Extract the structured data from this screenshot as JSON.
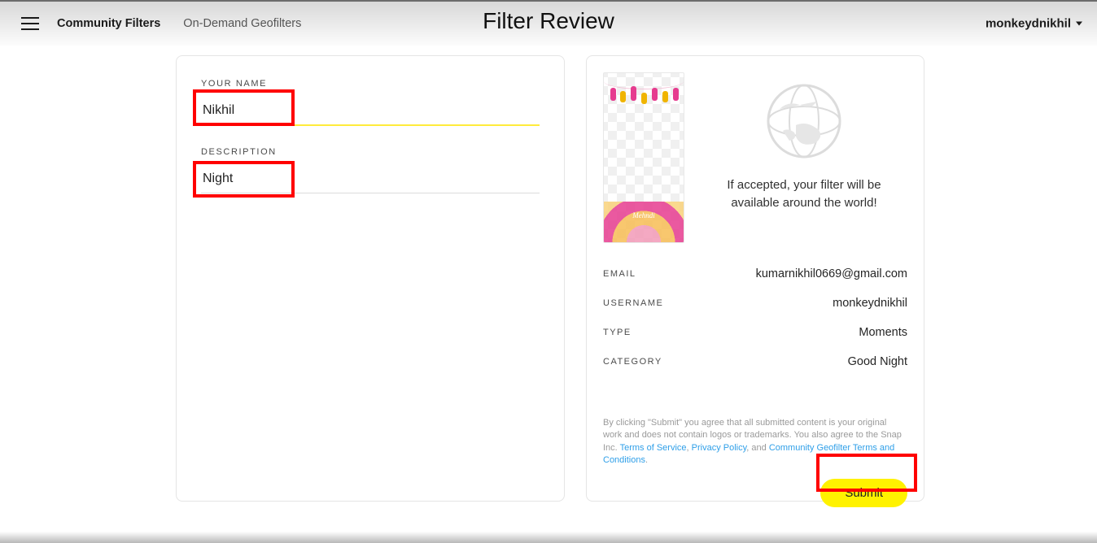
{
  "header": {
    "page_title": "Filter Review",
    "nav": {
      "community": "Community Filters",
      "ondemand": "On-Demand Geofilters"
    },
    "user": "monkeydnikhil"
  },
  "form": {
    "name_label": "YOUR NAME",
    "name_value": "Nikhil",
    "desc_label": "DESCRIPTION",
    "desc_value": "Night"
  },
  "preview": {
    "mehndi": "Mehndi"
  },
  "accept_text_l1": "If accepted, your filter will be",
  "accept_text_l2": "available around the world!",
  "info": {
    "email_k": "EMAIL",
    "email_v": "kumarnikhil0669@gmail.com",
    "username_k": "USERNAME",
    "username_v": "monkeydnikhil",
    "type_k": "TYPE",
    "type_v": "Moments",
    "category_k": "CATEGORY",
    "category_v": "Good Night"
  },
  "legal": {
    "pre": "By clicking \"Submit\" you agree that all submitted content is your original work and does not contain logos or trademarks. You also agree to the Snap Inc. ",
    "tos": "Terms of Service",
    "sep1": ", ",
    "privacy": "Privacy Policy",
    "sep2": ", and ",
    "geo": "Community Geofilter Terms and Conditions",
    "end": "."
  },
  "submit_label": "Submit"
}
